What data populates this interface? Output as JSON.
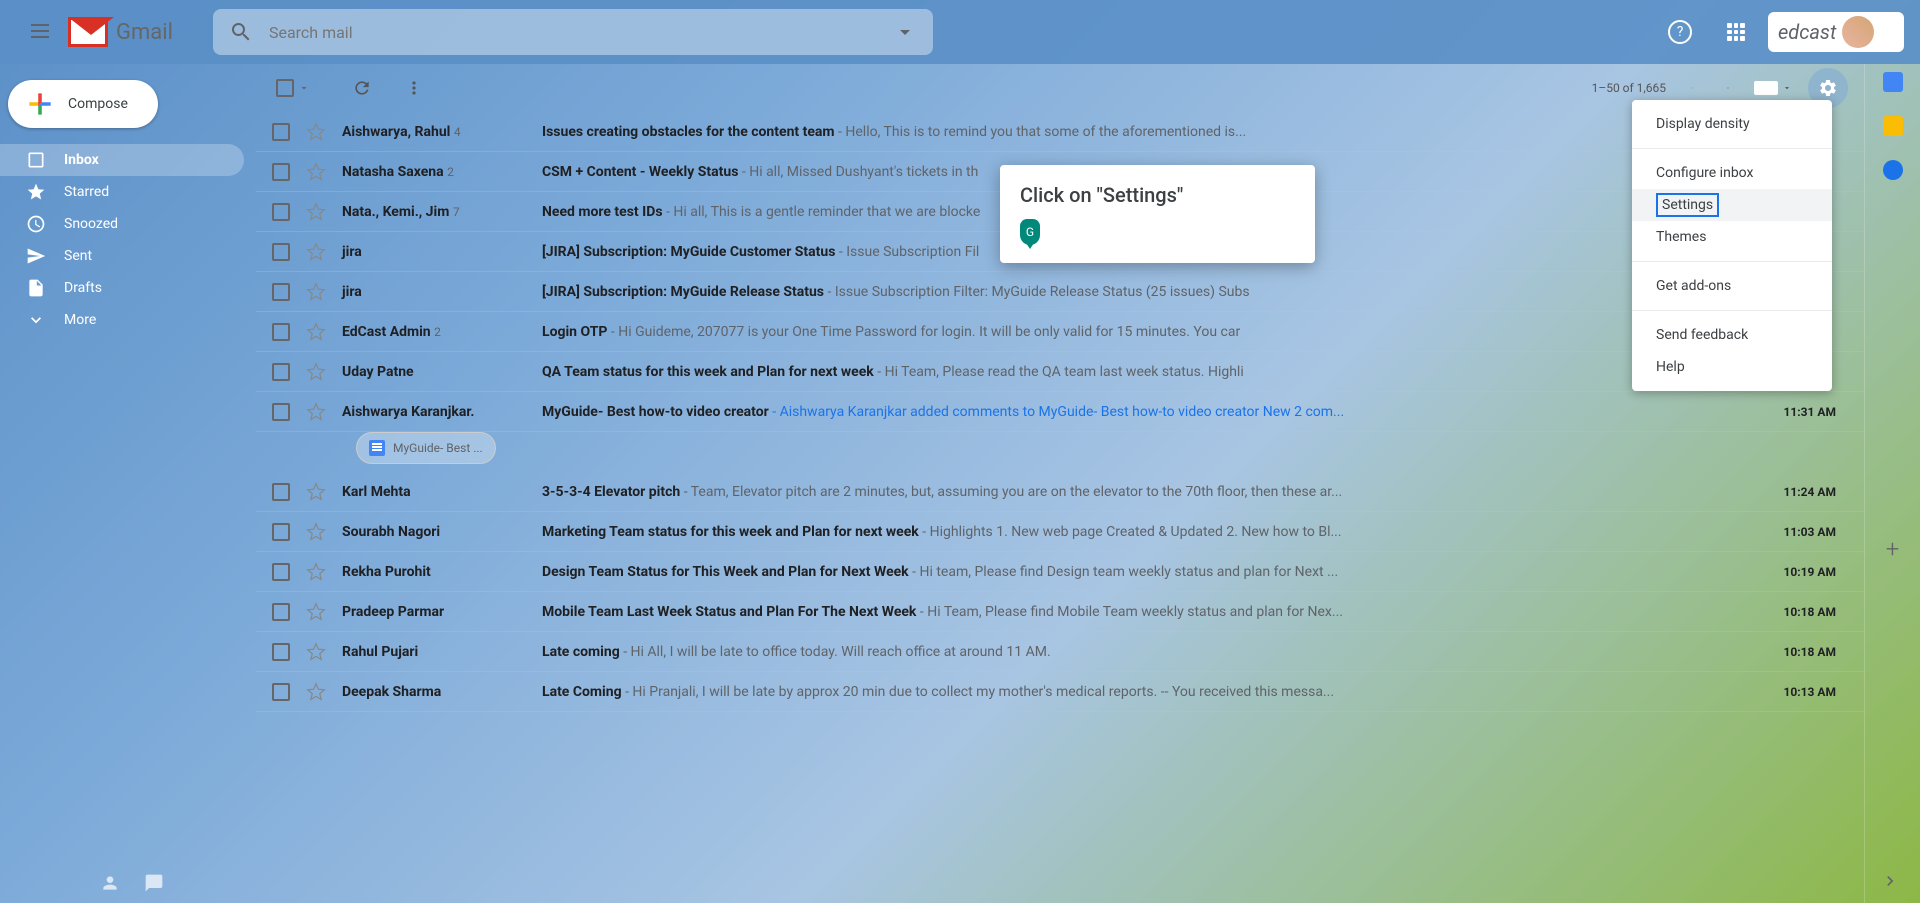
{
  "header": {
    "logo_text": "Gmail",
    "search_placeholder": "Search mail",
    "edcast_label": "edcast"
  },
  "sidebar": {
    "compose": "Compose",
    "items": [
      {
        "label": "Inbox"
      },
      {
        "label": "Starred"
      },
      {
        "label": "Snoozed"
      },
      {
        "label": "Sent"
      },
      {
        "label": "Drafts"
      },
      {
        "label": "More"
      }
    ]
  },
  "toolbar": {
    "pagination": "1–50 of 1,665"
  },
  "emails": [
    {
      "sender": "Aishwarya, Rahul",
      "count": "4",
      "subject": "Issues creating obstacles for the content team",
      "snippet": " - Hello, This is to remind you that some of the aforementioned is...",
      "time": ""
    },
    {
      "sender": "Natasha Saxena",
      "count": "2",
      "subject": "CSM + Content - Weekly Status",
      "snippet": " - Hi all, Missed Dushyant's tickets in th",
      "time": ""
    },
    {
      "sender": "Nata., Kemi., Jim",
      "count": "7",
      "subject": "Need more test IDs",
      "snippet": " - Hi all, This is a gentle reminder that we are blocke",
      "time": ""
    },
    {
      "sender": "jira",
      "count": "",
      "subject": "[JIRA] Subscription: MyGuide Customer Status",
      "snippet": " - Issue Subscription Fil",
      "time": ""
    },
    {
      "sender": "jira",
      "count": "",
      "subject": "[JIRA] Subscription: MyGuide Release Status",
      "snippet": " - Issue Subscription Filter: MyGuide Release Status (25 issues) Subs",
      "time": ""
    },
    {
      "sender": "EdCast Admin",
      "count": "2",
      "subject": "Login OTP",
      "snippet": " - Hi Guideme, 207077 is your One Time Password for login. It will be only valid for 15 minutes. You car",
      "time": ""
    },
    {
      "sender": "Uday Patne",
      "count": "",
      "subject": "QA Team status for this week and Plan for next week",
      "snippet": " - Hi Team, Please read the QA team last week status. Highli",
      "time": ""
    },
    {
      "sender": "Aishwarya Karanjkar.",
      "count": "",
      "subject": "MyGuide- Best how-to video creator",
      "snippet_link": " - Aishwarya Karanjkar added comments to MyGuide- Best how-to video creator New 2 com...",
      "time": "11:31 AM",
      "attachment": "MyGuide- Best ..."
    },
    {
      "sender": "Karl Mehta",
      "count": "",
      "subject": "3-5-3-4 Elevator pitch",
      "snippet": " - Team, Elevator pitch are 2 minutes, but, assuming you are on the elevator to the 70th floor, then these ar...",
      "time": "11:24 AM"
    },
    {
      "sender": "Sourabh Nagori",
      "count": "",
      "subject": "Marketing Team status for this week and Plan for next week",
      "snippet": " - Highlights 1. New web page Created & Updated 2. New how to Bl...",
      "time": "11:03 AM"
    },
    {
      "sender": "Rekha Purohit",
      "count": "",
      "subject": "Design Team Status for This Week and Plan for Next Week",
      "snippet": " - Hi team, Please find Design team weekly status and plan for Next ...",
      "time": "10:19 AM"
    },
    {
      "sender": "Pradeep Parmar",
      "count": "",
      "subject": "Mobile Team Last Week Status and Plan For The Next Week",
      "snippet": " - Hi Team, Please find Mobile Team weekly status and plan for Nex...",
      "time": "10:18 AM"
    },
    {
      "sender": "Rahul Pujari",
      "count": "",
      "subject": "Late coming",
      "snippet": " - Hi All, I will be late to office today. Will reach office at around 11 AM.",
      "time": "10:18 AM"
    },
    {
      "sender": "Deepak Sharma",
      "count": "",
      "subject": "Late Coming",
      "snippet": " - Hi Pranjali, I will be late by approx 20 min due to collect my mother's medical reports. -- You received this messa...",
      "time": "10:13 AM"
    }
  ],
  "settings_menu": {
    "items": [
      {
        "label": "Display density"
      },
      {
        "label": "Configure inbox"
      },
      {
        "label": "Settings",
        "highlighted": true
      },
      {
        "label": "Themes"
      },
      {
        "label": "Get add-ons"
      },
      {
        "label": "Send feedback"
      },
      {
        "label": "Help"
      }
    ]
  },
  "tooltip": {
    "text": "Click on \"Settings\"",
    "badge": "G"
  }
}
